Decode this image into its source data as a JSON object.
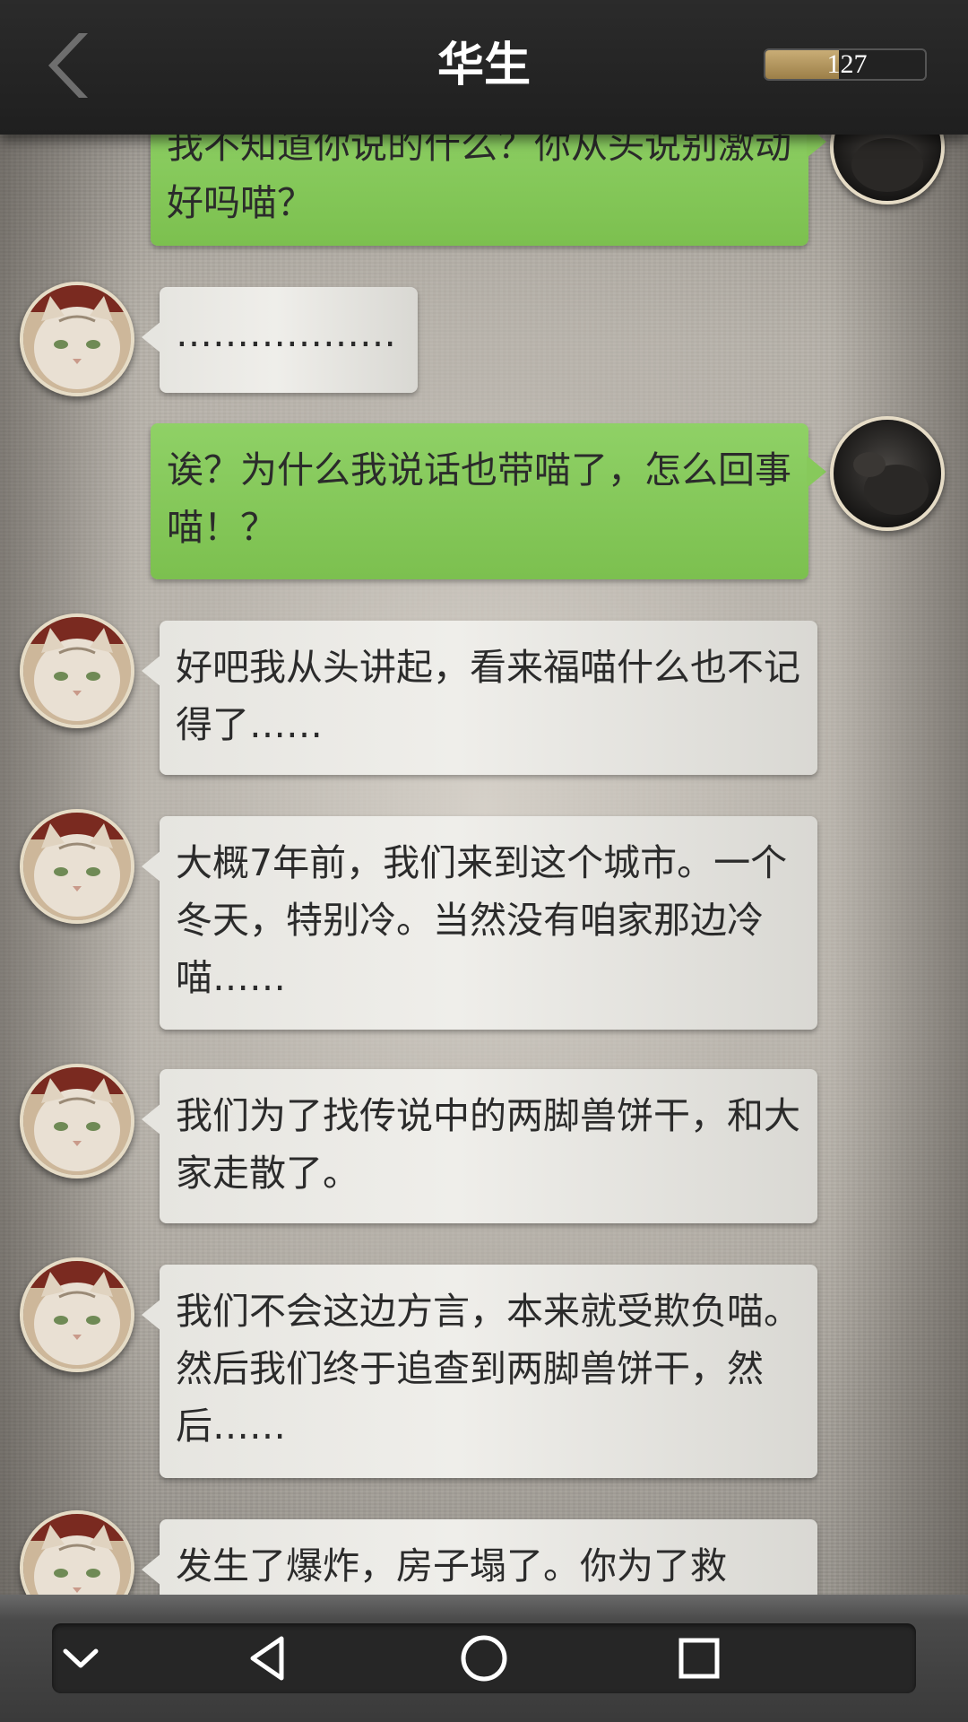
{
  "header": {
    "title": "华生",
    "score": "127",
    "score_fill_fraction": 0.46
  },
  "messages": [
    {
      "side": "right",
      "text": "我不知道你说的什么？你从头说别激动好吗喵？"
    },
    {
      "side": "left",
      "text": "………………"
    },
    {
      "side": "right",
      "text": "诶？为什么我说话也带喵了，怎么回事喵！？"
    },
    {
      "side": "left",
      "text": "好吧我从头讲起，看来福喵什么也不记得了……"
    },
    {
      "side": "left",
      "text": "大概7年前，我们来到这个城市。一个冬天，特别冷。当然没有咱家那边冷喵……"
    },
    {
      "side": "left",
      "text": "我们为了找传说中的两脚兽饼干，和大家走散了。"
    },
    {
      "side": "left",
      "text": "我们不会这边方言，本来就受欺负喵。然后我们终于追查到两脚兽饼干，然后……"
    },
    {
      "side": "left",
      "text": "发生了爆炸，房子塌了。你为了救"
    }
  ],
  "icons": {
    "back": "chevron-left-icon",
    "collapse": "chevron-down-icon",
    "nav_back": "triangle-back-icon",
    "home": "circle-home-icon",
    "recents": "square-recents-icon"
  },
  "colors": {
    "header_bg": "#222222",
    "bubble_self": "#84c658",
    "bubble_other": "#e6e5e0",
    "score_fill": "#b0925c"
  }
}
